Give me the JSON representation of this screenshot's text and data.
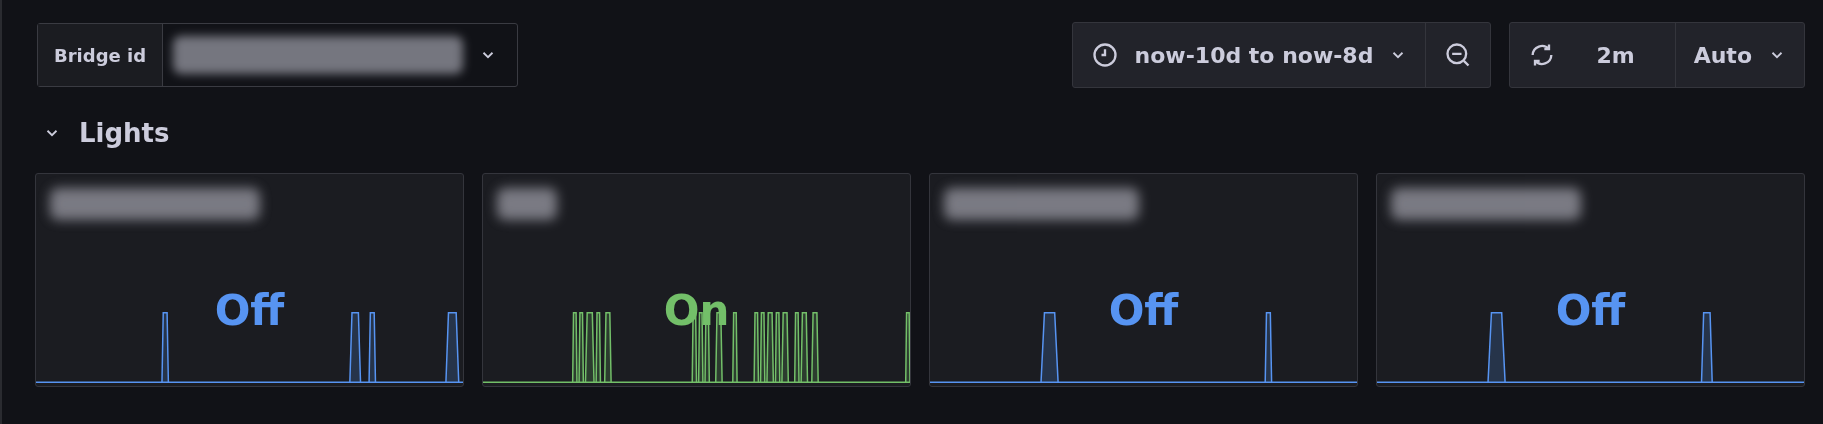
{
  "variable": {
    "label": "Bridge id"
  },
  "time_picker": {
    "range": "now-10d to now-8d"
  },
  "refresh": {
    "interval": "2m",
    "mode": "Auto"
  },
  "row": {
    "title": "Lights",
    "expanded": true
  },
  "panels": [
    {
      "value": "Off",
      "color": "#5794f2"
    },
    {
      "value": "On",
      "color": "#73bf69"
    },
    {
      "value": "Off",
      "color": "#5794f2"
    },
    {
      "value": "Off",
      "color": "#5794f2"
    }
  ]
}
